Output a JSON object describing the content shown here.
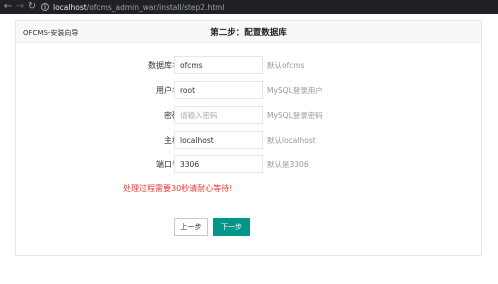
{
  "browser": {
    "url_host": "localhost",
    "url_path": "/ofcms_admin_war/install/step2.html"
  },
  "header": {
    "brand": "OFCMS-安装向导",
    "title": "第二步：配置数据库"
  },
  "form": {
    "rows": [
      {
        "label": "数据库名",
        "value": "ofcms",
        "placeholder": "",
        "hint": "默认ofcms"
      },
      {
        "label": "用户名",
        "value": "root",
        "placeholder": "",
        "hint": "MySQL登录用户"
      },
      {
        "label": "密码",
        "value": "",
        "placeholder": "请输入密码",
        "hint": "MySQL登录密码"
      },
      {
        "label": "主机",
        "value": "localhost",
        "placeholder": "",
        "hint": "默认localhost"
      },
      {
        "label": "端口号",
        "value": "3306",
        "placeholder": "",
        "hint": "默认是3306"
      }
    ],
    "warning": "处理过程需要30秒请耐心等待!"
  },
  "actions": {
    "prev_label": "上一步",
    "next_label": "下一步"
  },
  "colors": {
    "primary": "#009688",
    "warning": "#e53935",
    "browser_chrome": "#202124"
  }
}
